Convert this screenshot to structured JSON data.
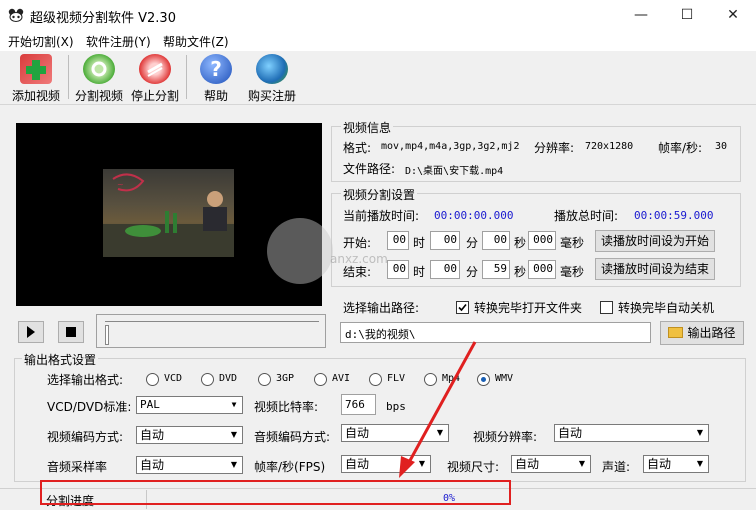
{
  "window": {
    "title": "超级视频分割软件 V2.30",
    "minimize": "—",
    "maximize": "☐",
    "close": "✕"
  },
  "menu": [
    "开始切割(X)",
    "软件注册(Y)",
    "帮助文件(Z)"
  ],
  "toolbar": [
    {
      "label": "添加视频",
      "icon": "add-video-icon",
      "color": "#2aa84a"
    },
    {
      "label": "分割视频",
      "icon": "split-video-icon",
      "color": "#5cb85c"
    },
    {
      "label": "停止分割",
      "icon": "stop-split-icon",
      "color": "#e04848"
    },
    {
      "label": "帮助",
      "icon": "help-icon",
      "color": "#2f6fd6"
    },
    {
      "label": "购买注册",
      "icon": "buy-register-icon",
      "color": "#3a8a3a"
    }
  ],
  "video_info": {
    "group_title": "视频信息",
    "format_label": "格式:",
    "format_value": "mov,mp4,m4a,3gp,3g2,mj2",
    "resolution_label": "分辨率:",
    "resolution_value": "720x1280",
    "fps_label": "帧率/秒:",
    "fps_value": "30",
    "path_label": "文件路径:",
    "path_value": "D:\\桌面\\安下载.mp4"
  },
  "split_settings": {
    "group_title": "视频分割设置",
    "current_label": "当前播放时间:",
    "current_value": "00:00:00.000",
    "total_label": "播放总时间:",
    "total_value": "00:00:59.000",
    "start_label": "开始:",
    "end_label": "结束:",
    "unit_hour": "时",
    "unit_min": "分",
    "unit_sec": "秒",
    "unit_ms": "毫秒",
    "start": {
      "h": "00",
      "m": "00",
      "s": "00",
      "ms": "000"
    },
    "end": {
      "h": "00",
      "m": "00",
      "s": "59",
      "ms": "000"
    },
    "set_start_button": "读播放时间设为开始",
    "set_end_button": "读播放时间设为结束"
  },
  "output": {
    "path_label": "选择输出路径:",
    "open_folder_label": "转换完毕打开文件夹",
    "open_folder_checked": true,
    "auto_shutdown_label": "转换完毕自动关机",
    "auto_shutdown_checked": false,
    "path_value": "d:\\我的视频\\",
    "output_path_button": "输出路径"
  },
  "format_settings": {
    "group_title": "输出格式设置",
    "select_format_label": "选择输出格式:",
    "formats": [
      "VCD",
      "DVD",
      "3GP",
      "AVI",
      "FLV",
      "Mp4",
      "WMV"
    ],
    "selected_format": "WMV",
    "vcd_std_label": "VCD/DVD标准:",
    "vcd_std_value": "PAL",
    "bitrate_label": "视频比特率:",
    "bitrate_value": "766",
    "bitrate_unit": "bps",
    "vcodec_label": "视频编码方式:",
    "vcodec_value": "自动",
    "acodec_label": "音频编码方式:",
    "acodec_value": "自动",
    "vres_label": "视频分辨率:",
    "vres_value": "自动",
    "asample_label": "音频采样率",
    "asample_value": "自动",
    "fps_label": "帧率/秒(FPS)",
    "fps_value": "自动",
    "vsize_label": "视频尺寸:",
    "vsize_value": "自动",
    "channel_label": "声道:",
    "channel_value": "自动"
  },
  "status": {
    "progress_label": "分割进度",
    "progress_text": "0%",
    "progress": 0
  },
  "watermark": {
    "text": "anxz.com"
  },
  "annotation_color": "#e02020"
}
